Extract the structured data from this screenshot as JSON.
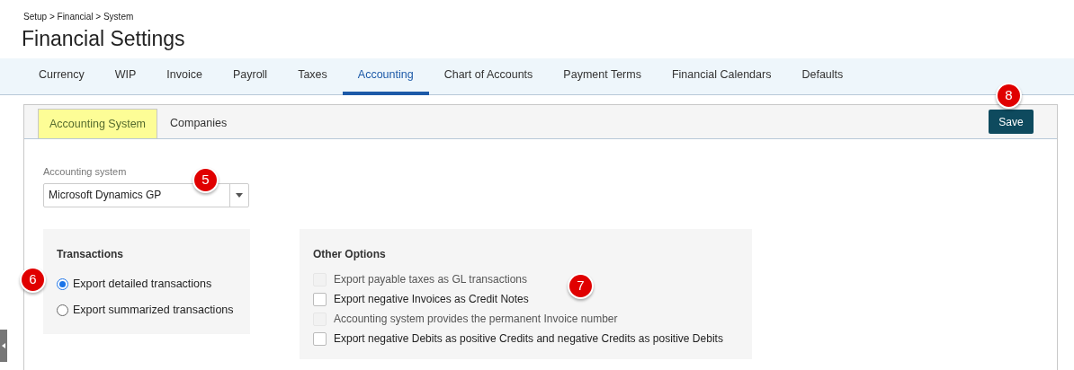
{
  "breadcrumb": "Setup > Financial > System",
  "title": "Financial Settings",
  "tabs": [
    {
      "label": "Currency",
      "selected": false
    },
    {
      "label": "WIP",
      "selected": false
    },
    {
      "label": "Invoice",
      "selected": false
    },
    {
      "label": "Payroll",
      "selected": false
    },
    {
      "label": "Taxes",
      "selected": false
    },
    {
      "label": "Accounting",
      "selected": true
    },
    {
      "label": "Chart of Accounts",
      "selected": false
    },
    {
      "label": "Payment Terms",
      "selected": false
    },
    {
      "label": "Financial Calendars",
      "selected": false
    },
    {
      "label": "Defaults",
      "selected": false
    }
  ],
  "subtabs": [
    {
      "label": "Accounting System",
      "selected": true,
      "highlighted": true
    },
    {
      "label": "Companies",
      "selected": false,
      "highlighted": false
    }
  ],
  "save_button": "Save",
  "accounting_system": {
    "label": "Accounting system",
    "value": "Microsoft Dynamics GP"
  },
  "transactions": {
    "title": "Transactions",
    "options": [
      {
        "label": "Export detailed transactions",
        "selected": true
      },
      {
        "label": "Export summarized transactions",
        "selected": false
      }
    ]
  },
  "other_options": {
    "title": "Other Options",
    "options": [
      {
        "label": "Export payable taxes as GL transactions",
        "checked": false,
        "disabled": true
      },
      {
        "label": "Export negative Invoices as Credit Notes",
        "checked": false,
        "disabled": false
      },
      {
        "label": "Accounting system provides the permanent Invoice number",
        "checked": false,
        "disabled": true
      },
      {
        "label": "Export negative Debits as positive Credits and negative Credits as positive Debits",
        "checked": false,
        "disabled": false
      }
    ]
  },
  "callouts": [
    {
      "number": "5"
    },
    {
      "number": "6"
    },
    {
      "number": "7"
    },
    {
      "number": "8"
    }
  ]
}
